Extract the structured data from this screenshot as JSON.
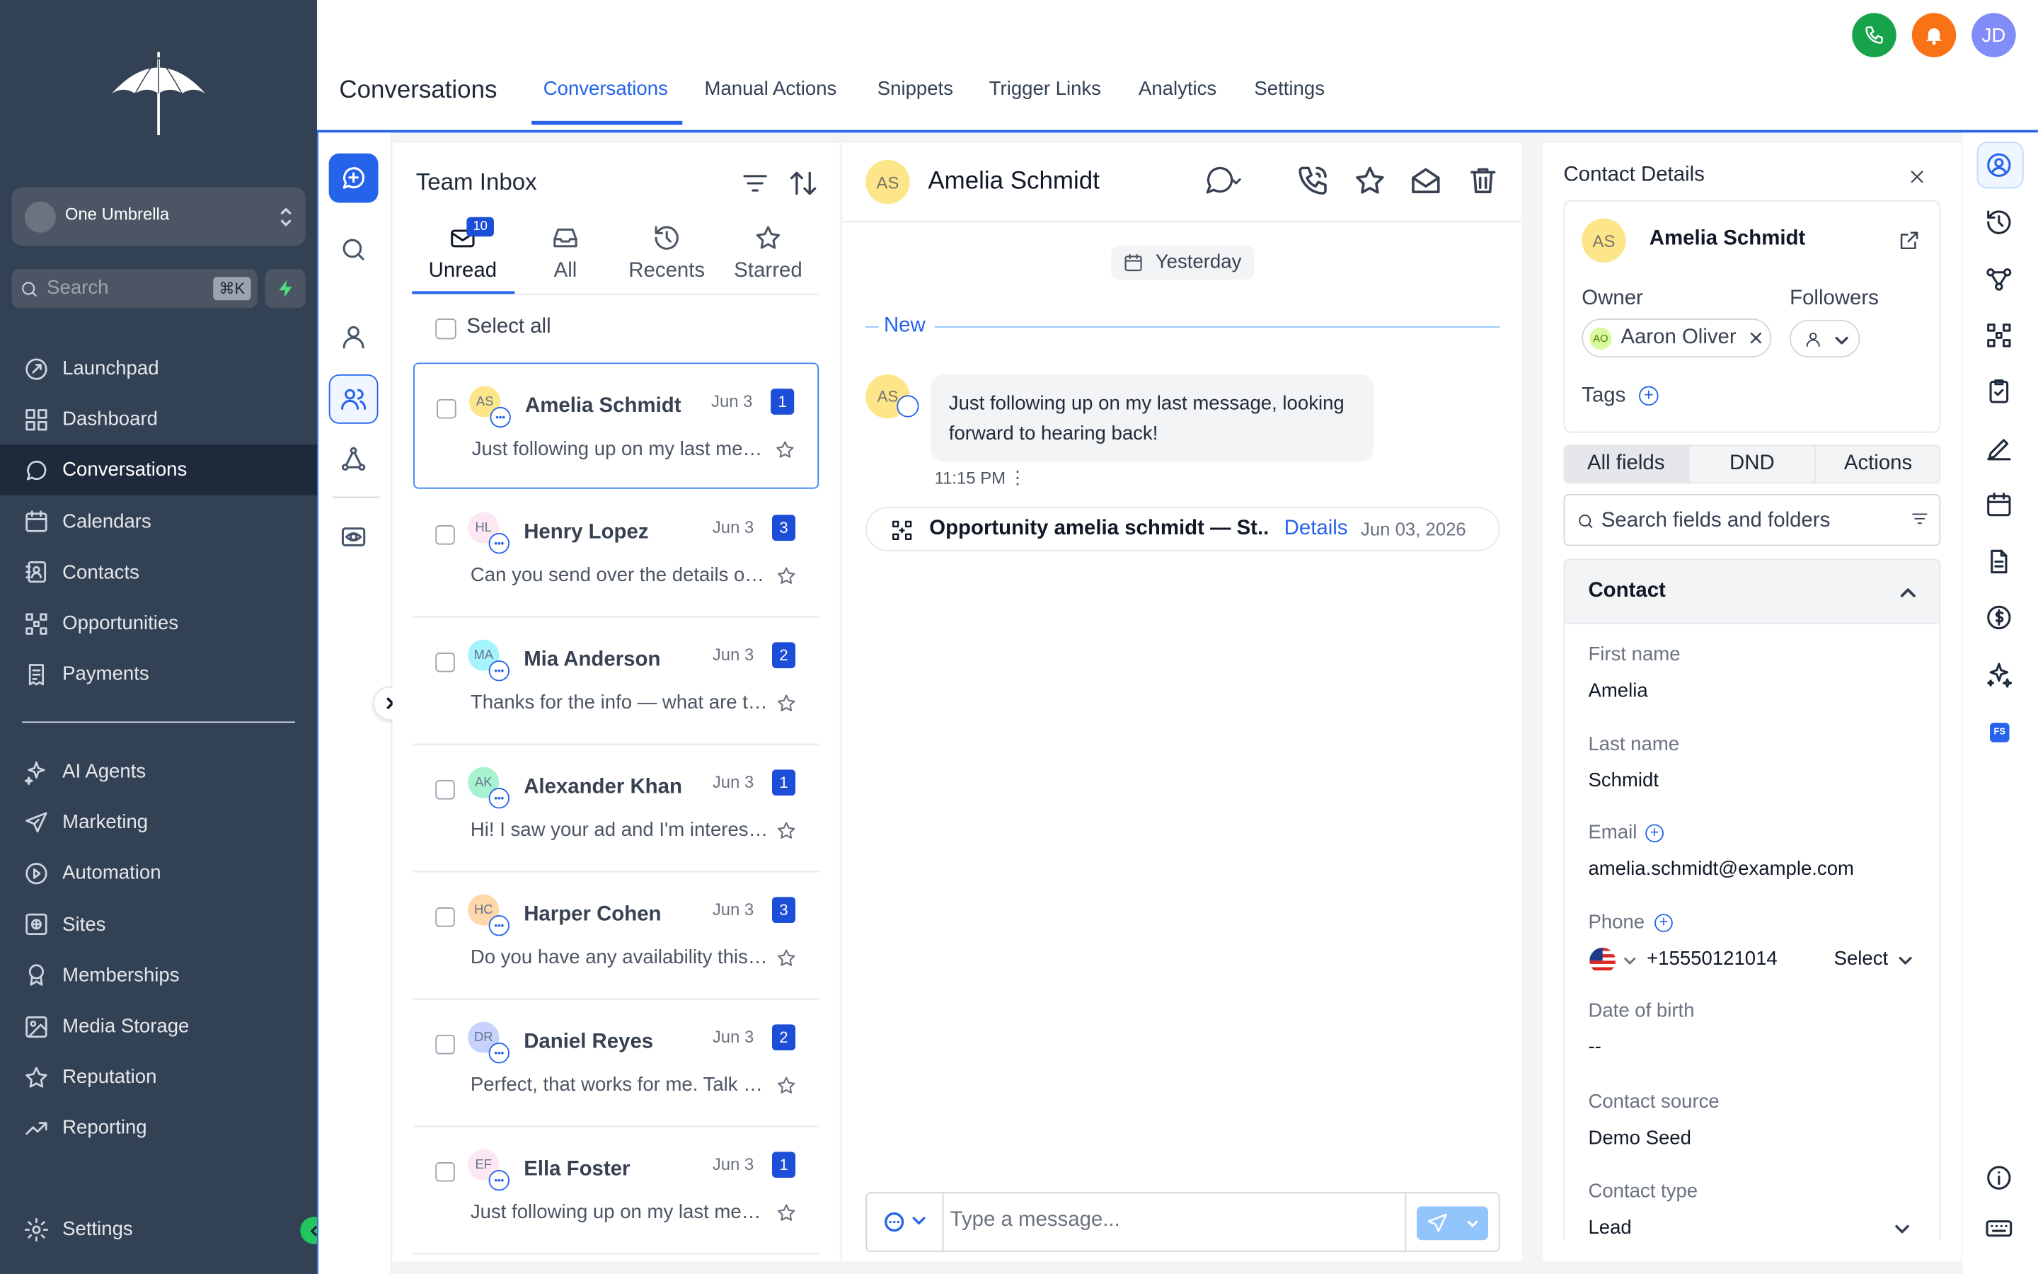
{
  "sidebar": {
    "account": "One Umbrella",
    "search_placeholder": "Search",
    "search_shortcut": "⌘K",
    "items": [
      {
        "label": "Launchpad",
        "icon": "rocket-icon"
      },
      {
        "label": "Dashboard",
        "icon": "grid-icon"
      },
      {
        "label": "Conversations",
        "icon": "chat-icon",
        "active": true
      },
      {
        "label": "Calendars",
        "icon": "calendar-icon"
      },
      {
        "label": "Contacts",
        "icon": "contact-book-icon"
      },
      {
        "label": "Opportunities",
        "icon": "pipeline-icon"
      },
      {
        "label": "Payments",
        "icon": "receipt-icon"
      }
    ],
    "items2": [
      {
        "label": "AI Agents",
        "icon": "sparkles-icon"
      },
      {
        "label": "Marketing",
        "icon": "send-icon"
      },
      {
        "label": "Automation",
        "icon": "automation-icon"
      },
      {
        "label": "Sites",
        "icon": "globe-icon"
      },
      {
        "label": "Memberships",
        "icon": "award-icon"
      },
      {
        "label": "Media Storage",
        "icon": "image-icon"
      },
      {
        "label": "Reputation",
        "icon": "star-icon"
      },
      {
        "label": "Reporting",
        "icon": "trend-icon"
      }
    ],
    "settings_label": "Settings"
  },
  "header": {
    "title": "Conversations",
    "tabs": [
      "Conversations",
      "Manual Actions",
      "Snippets",
      "Trigger Links",
      "Analytics",
      "Settings"
    ],
    "active_tab": "Conversations",
    "user_initials": "JD"
  },
  "inbox": {
    "title": "Team Inbox",
    "filter_tabs": [
      {
        "label": "Unread",
        "count": "10"
      },
      {
        "label": "All"
      },
      {
        "label": "Recents"
      },
      {
        "label": "Starred"
      }
    ],
    "select_all": "Select all",
    "conversations": [
      {
        "initials": "AS",
        "name": "Amelia Schmidt",
        "date": "Jun 3",
        "unread": "1",
        "preview": "Just following up on my last message, looking forward to hearing back!",
        "avatar_color": "#fde68a"
      },
      {
        "initials": "HL",
        "name": "Henry Lopez",
        "date": "Jun 3",
        "unread": "3",
        "preview": "Can you send over the details on pricing?",
        "avatar_color": "#fce7f3"
      },
      {
        "initials": "MA",
        "name": "Mia Anderson",
        "date": "Jun 3",
        "unread": "2",
        "preview": "Thanks for the info — what are the next steps?",
        "avatar_color": "#a5f3fc"
      },
      {
        "initials": "AK",
        "name": "Alexander Khan",
        "date": "Jun 3",
        "unread": "1",
        "preview": "Hi! I saw your ad and I'm interested.",
        "avatar_color": "#a7f3d0"
      },
      {
        "initials": "HC",
        "name": "Harper Cohen",
        "date": "Jun 3",
        "unread": "3",
        "preview": "Do you have any availability this week?",
        "avatar_color": "#fed7aa"
      },
      {
        "initials": "DR",
        "name": "Daniel Reyes",
        "date": "Jun 3",
        "unread": "2",
        "preview": "Perfect, that works for me. Talk soon!",
        "avatar_color": "#c7d2fe"
      },
      {
        "initials": "EF",
        "name": "Ella Foster",
        "date": "Jun 3",
        "unread": "1",
        "preview": "Just following up on my last message, thanks!",
        "avatar_color": "#fce7f3"
      }
    ]
  },
  "chat": {
    "contact_initials": "AS",
    "contact_name": "Amelia Schmidt",
    "day_label": "Yesterday",
    "new_label": "New",
    "message": "Just following up on my last message, looking forward to hearing back!",
    "message_time": "11:15 PM",
    "opportunity_text": "Opportunity amelia schmidt — St...",
    "opportunity_link": "Details",
    "opportunity_date": "Jun 03, 2026",
    "composer_placeholder": "Type a message..."
  },
  "contact_panel": {
    "title": "Contact Details",
    "initials": "AS",
    "name": "Amelia Schmidt",
    "owner_label": "Owner",
    "owner_initials": "AO",
    "owner_name": "Aaron Oliver",
    "followers_label": "Followers",
    "tags_label": "Tags",
    "tabs": [
      "All fields",
      "DND",
      "Actions"
    ],
    "search_placeholder": "Search fields and folders",
    "section": "Contact",
    "first_name_label": "First name",
    "first_name": "Amelia",
    "last_name_label": "Last name",
    "last_name": "Schmidt",
    "email_label": "Email",
    "email": "amelia.schmidt@example.com",
    "phone_label": "Phone",
    "phone": "+15550121014",
    "phone_type": "Select",
    "dob_label": "Date of birth",
    "dob": "--",
    "source_label": "Contact source",
    "source": "Demo Seed",
    "type_label": "Contact type",
    "type": "Lead",
    "rail_badge": "FS"
  },
  "colors": {
    "sidebar": "#334155",
    "accent": "#2563eb",
    "active_nav": "#1e293b",
    "phone": "#16a34a",
    "bell": "#f97316",
    "avatar": "#818cf8"
  }
}
